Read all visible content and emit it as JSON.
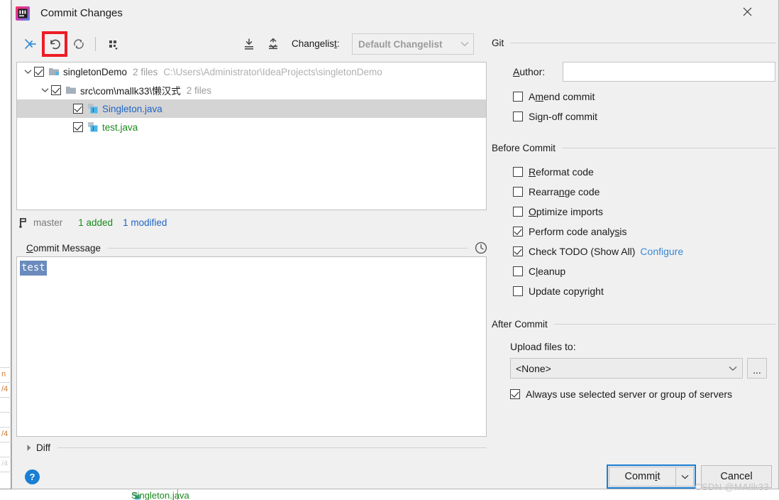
{
  "window": {
    "title": "Commit Changes",
    "app_icon": "intellij-idea-icon",
    "close_label": "✕"
  },
  "toolbar": {
    "buttons": [
      {
        "name": "collapse-selection-icon",
        "tooltip": "Move to Another Changelist"
      },
      {
        "name": "rollback-icon",
        "tooltip": "Rollback",
        "highlighted": true
      },
      {
        "name": "refresh-icon",
        "tooltip": "Refresh Changes"
      },
      {
        "name": "group-by-icon",
        "tooltip": "Group By"
      },
      {
        "name": "expand-all-icon",
        "tooltip": "Expand All"
      },
      {
        "name": "collapse-all-icon",
        "tooltip": "Collapse All"
      }
    ],
    "highlight_color": "#ee1b24",
    "changelist_label": "Changelist:",
    "changelist_label_mnemonic": "t",
    "changelist_value": "Default Changelist",
    "changelist_disabled": true
  },
  "tree": {
    "rows": [
      {
        "indent": 0,
        "twisty": "expanded",
        "checked": true,
        "icon": "project-folder-icon",
        "name": "singletonDemo",
        "name_color": "#1a1a1a",
        "meta": "2 files",
        "path": "C:\\Users\\Administrator\\IdeaProjects\\singletonDemo",
        "selected": false
      },
      {
        "indent": 1,
        "twisty": "expanded",
        "checked": true,
        "icon": "folder-icon",
        "name": "src\\com\\mallk33\\懒汉式",
        "name_color": "#1a1a1a",
        "meta": "2 files",
        "path": "",
        "selected": false
      },
      {
        "indent": 2,
        "twisty": "none",
        "checked": true,
        "icon": "java-class-icon",
        "name": "Singleton.java",
        "name_color": "#1f64c4",
        "meta": "",
        "path": "",
        "selected": true,
        "status": "modified"
      },
      {
        "indent": 2,
        "twisty": "none",
        "checked": true,
        "icon": "java-class-icon",
        "name": "test.java",
        "name_color": "#1a8b1a",
        "meta": "",
        "path": "",
        "selected": false,
        "status": "added"
      }
    ]
  },
  "status": {
    "branch_icon": "git-branch-icon",
    "branch": "master",
    "added": "1 added",
    "modified": "1 modified",
    "added_color": "#1a8b1a",
    "modified_color": "#1f64c4"
  },
  "commit_message": {
    "label_prefix": "",
    "label_mnemonic": "C",
    "label_rest": "ommit Message",
    "history_icon": "clock-history-icon",
    "value": "test",
    "selected": true
  },
  "diff": {
    "label": "Diff",
    "expanded": false,
    "twisty": "collapsed"
  },
  "help": {
    "icon": "help-question-icon",
    "label": "?"
  },
  "git_section": {
    "title": "Git",
    "author_label_mnemonic": "A",
    "author_label_rest": "uthor:",
    "author_value": "",
    "author_placeholder": "",
    "checkboxes": [
      {
        "name": "amend-commit",
        "pre": "A",
        "mn": "m",
        "post": "end commit",
        "checked": false
      },
      {
        "name": "sign-off-commit",
        "pre": "Si",
        "mn": "g",
        "post": "n-off commit",
        "checked": false
      }
    ]
  },
  "before_commit_section": {
    "title": "Before Commit",
    "checkboxes": [
      {
        "name": "reformat-code",
        "pre": "",
        "mn": "R",
        "post": "eformat code",
        "checked": false
      },
      {
        "name": "rearrange-code",
        "pre": "Rearra",
        "mn": "n",
        "post": "ge code",
        "checked": false
      },
      {
        "name": "optimize-imports",
        "pre": "",
        "mn": "O",
        "post": "ptimize imports",
        "checked": false
      },
      {
        "name": "perform-code-analysis",
        "pre": "Perform code analy",
        "mn": "s",
        "post": "is",
        "checked": true
      },
      {
        "name": "check-todo",
        "pre": "Check TODO (Show All)",
        "mn": "",
        "post": "",
        "checked": true,
        "link": "Configure"
      },
      {
        "name": "cleanup",
        "pre": "C",
        "mn": "l",
        "post": "eanup",
        "checked": false
      },
      {
        "name": "update-copyright",
        "pre": "Update copyright",
        "mn": "",
        "post": "",
        "checked": false
      }
    ]
  },
  "after_commit_section": {
    "title": "After Commit",
    "upload_label": "Upload files to:",
    "upload_value": "<None>",
    "ellipsis_label": "...",
    "always_checkbox": {
      "name": "always-use-selected-server",
      "label": "Always use selected server or group of servers",
      "checked": true
    }
  },
  "footer": {
    "commit_pre": "Comm",
    "commit_mn": "i",
    "commit_post": "t",
    "commit_focused": true,
    "commit_split_icon": "chevron-down-icon",
    "cancel_label": "Cancel",
    "watermark": "CSDN @MAllk33",
    "focus_color": "#1a7fd4"
  },
  "background": {
    "file_label": "Singleton.java",
    "file_color": "#1a8b1a"
  }
}
